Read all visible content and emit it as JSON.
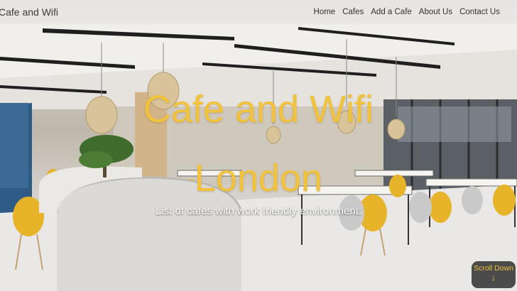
{
  "navbar": {
    "brand": "Cafe and Wifi",
    "links": [
      "Home",
      "Cafes",
      "Add a Cafe",
      "About Us",
      "Contact Us"
    ]
  },
  "hero": {
    "title_line1": "Cafe and Wifi",
    "title_line2": "London",
    "subtitle": "List of cafes with work friendly environment."
  },
  "scroll_button": {
    "label": "Scroll Down",
    "arrow": "↓"
  },
  "colors": {
    "accent": "#f2c23c",
    "navbar_bg": "#f5f5f5",
    "button_bg": "#282828"
  },
  "icons": [
    "arrow-down-icon"
  ]
}
